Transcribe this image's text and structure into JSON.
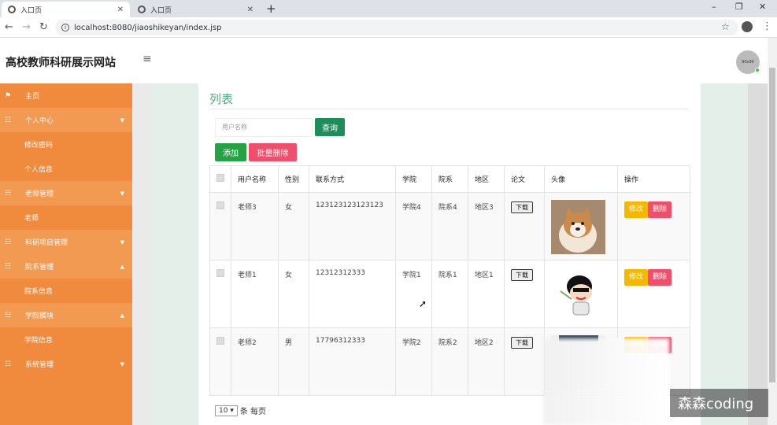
{
  "browser": {
    "tabs": [
      {
        "label": "入口页"
      },
      {
        "label": "入口页"
      }
    ],
    "url": "localhost:8080/jiaoshikeyan/index.jsp"
  },
  "header": {
    "site_title": "高校教师科研展示网站",
    "avatar_text": "90x90"
  },
  "sidebar": {
    "home": "主页",
    "personal_center": "个人中心",
    "change_password": "修改密码",
    "personal_info": "个人信息",
    "teacher_mgmt": "老师管理",
    "teacher": "老师",
    "research_mgmt": "科研项目管理",
    "dept_mgmt": "院系管理",
    "dept_info": "院系信息",
    "college_module": "学院模块",
    "college_info": "学院信息",
    "system_mgmt": "系统管理"
  },
  "main": {
    "title": "列表",
    "search_placeholder": "用户名称",
    "query_label": "查询",
    "add_label": "添加",
    "batch_delete_label": "批量删除",
    "columns": [
      "用户名称",
      "性别",
      "联系方式",
      "学院",
      "院系",
      "地区",
      "论文",
      "头像",
      "操作"
    ],
    "download_label": "下载",
    "edit_label": "修改",
    "delete_label": "删除",
    "rows": [
      {
        "name": "老师3",
        "gender": "女",
        "phone": "123123123123123",
        "college": "学院4",
        "dept": "院系4",
        "region": "地区3",
        "avatar": "dog"
      },
      {
        "name": "老师1",
        "gender": "女",
        "phone": "12312312333",
        "college": "学院1",
        "dept": "院系1",
        "region": "地区1",
        "avatar": "cartoon-boy"
      },
      {
        "name": "老师2",
        "gender": "男",
        "phone": "17796312333",
        "college": "学院2",
        "dept": "院系2",
        "region": "地区2",
        "avatar": "photo"
      }
    ],
    "page_size": "10",
    "page_size_suffix": "条 每页"
  },
  "watermark": "森森coding",
  "colors": {
    "sidebar": "#f08a3c",
    "title_green": "#4caf7a",
    "query_btn": "#1d8e5b",
    "add_btn": "#25a244",
    "delete_btn": "#f04e6a",
    "edit_btn": "#f5b800"
  }
}
